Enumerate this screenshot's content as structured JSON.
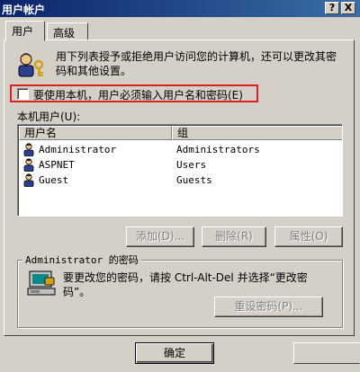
{
  "window": {
    "title": "用户帐户",
    "controls": {
      "help": "?",
      "close": "X"
    }
  },
  "tabs": [
    {
      "label": "用户",
      "active": true
    },
    {
      "label": "高级",
      "active": false
    }
  ],
  "intro": {
    "text": "用下列表授予或拒绝用户访问您的计算机，还可以更改其密码和其他设置。"
  },
  "require_login": {
    "label": "要使用本机，用户必须输入用户名和密码(E)",
    "checked": false
  },
  "users_section": {
    "label": "本机用户(U):",
    "columns": [
      "用户名",
      "组"
    ],
    "rows": [
      {
        "name": "Administrator",
        "group": "Administrators"
      },
      {
        "name": "ASPNET",
        "group": "Users"
      },
      {
        "name": "Guest",
        "group": "Guests"
      }
    ]
  },
  "buttons": {
    "add": "添加(D)...",
    "remove": "删除(R)",
    "properties": "属性(O)"
  },
  "password_group": {
    "title": "Administrator 的密码",
    "text": "要更改您的密码，请按 Ctrl-Alt-Del 并选择“更改密码”。",
    "reset_button": "重设密码(P)..."
  },
  "footer": {
    "ok": "确定"
  },
  "colors": {
    "title_bar": "#0a246a",
    "face": "#d4d0c8",
    "highlight_box": "#e02020"
  }
}
